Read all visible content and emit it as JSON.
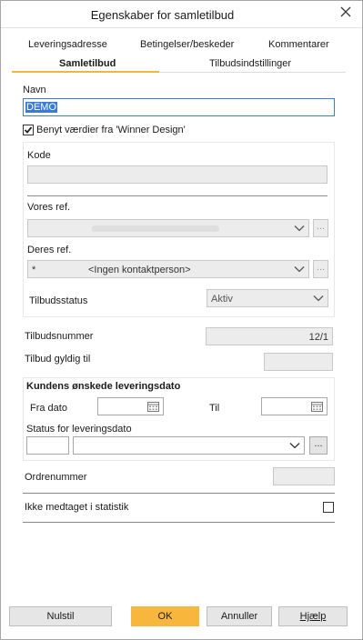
{
  "window": {
    "title": "Egenskaber for samletilbud"
  },
  "tabs_row1": [
    "Leveringsadresse",
    "Betingelser/beskeder",
    "Kommentarer"
  ],
  "tabs_row2": [
    "Samletilbud",
    "Tilbudsindstillinger"
  ],
  "active_tab": "Samletilbud",
  "navn": {
    "label": "Navn",
    "value": "DEMO"
  },
  "benyt": {
    "label": "Benyt værdier fra 'Winner Design'",
    "checked": true
  },
  "kode": {
    "label": "Kode",
    "value": ""
  },
  "vores_ref": {
    "label": "Vores ref.",
    "value": ""
  },
  "deres_ref": {
    "label": "Deres ref.",
    "prefix": "*",
    "value": "<Ingen kontaktperson>"
  },
  "tilbudsstatus": {
    "label": "Tilbudsstatus",
    "value": "Aktiv"
  },
  "tilbudsnummer": {
    "label": "Tilbudsnummer",
    "value": "12/1"
  },
  "gyldig_til": {
    "label": "Tilbud gyldig til",
    "value": ""
  },
  "kunde_dato": {
    "heading": "Kundens ønskede leveringsdato",
    "fra_label": "Fra dato",
    "til_label": "Til",
    "status_label": "Status for leveringsdato"
  },
  "ordrenummer": {
    "label": "Ordrenummer",
    "value": ""
  },
  "statistik": {
    "label": "Ikke medtaget i statistik",
    "checked": false
  },
  "buttons": {
    "reset": "Nulstil",
    "ok": "OK",
    "cancel": "Annuller",
    "help": "Hjælp"
  },
  "colors": {
    "accent": "#f6b73c",
    "focus": "#3b7ad9"
  }
}
